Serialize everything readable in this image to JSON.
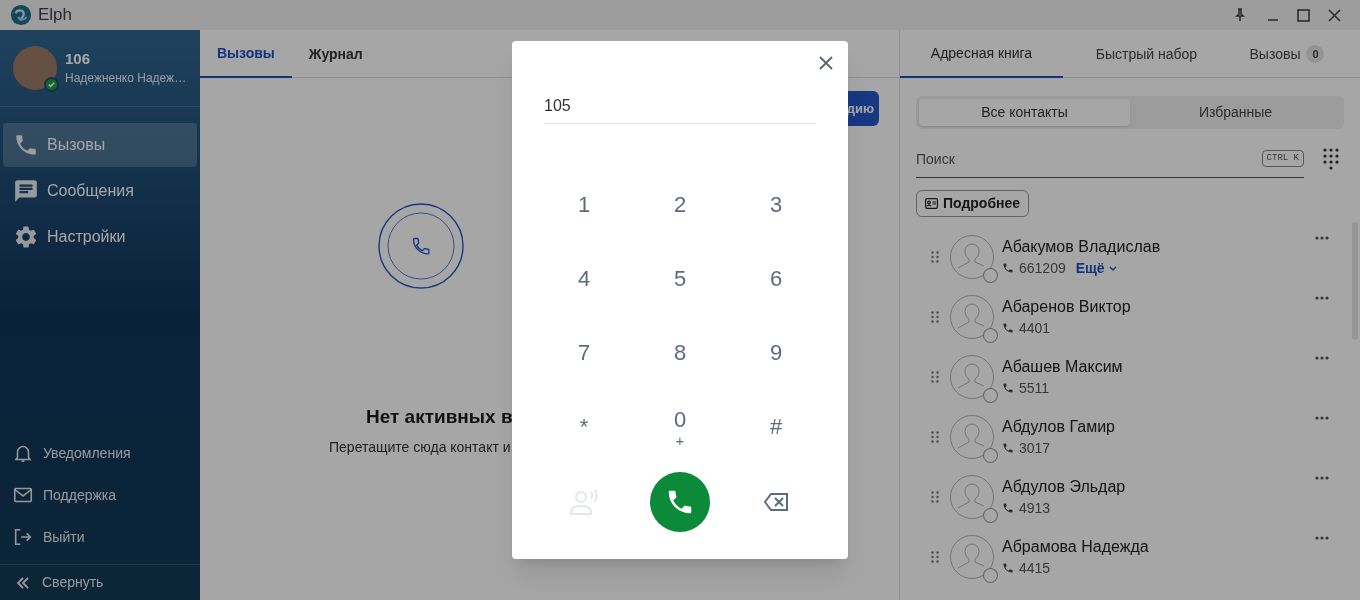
{
  "window": {
    "title": "Elph"
  },
  "user": {
    "extension": "106",
    "name": "Надежненко Надеж…",
    "online": true
  },
  "nav": [
    {
      "label": "Вызовы",
      "selected": true
    },
    {
      "label": "Сообщения",
      "selected": false
    },
    {
      "label": "Настройки",
      "selected": false
    }
  ],
  "bottom_nav": [
    {
      "label": "Уведомления"
    },
    {
      "label": "Поддержка"
    },
    {
      "label": "Выйти"
    }
  ],
  "collapse": {
    "label": "Свернуть"
  },
  "main": {
    "tabs": [
      {
        "label": "Вызовы",
        "selected": true
      },
      {
        "label": "Журнал",
        "selected": false
      }
    ],
    "action_button": "дию",
    "empty_title": "Нет активных в",
    "empty_text": "Перетащите сюда контакт и"
  },
  "contacts_panel": {
    "tabs": [
      {
        "label": "Адресная книга",
        "selected": true
      },
      {
        "label": "Быстрый набор",
        "selected": false
      },
      {
        "label": "Вызовы",
        "selected": false,
        "badge": "0"
      }
    ],
    "filters": [
      {
        "label": "Все контакты",
        "selected": true
      },
      {
        "label": "Избранные",
        "selected": false
      }
    ],
    "search": {
      "placeholder": "Поиск",
      "shortcut": "CTRL K"
    },
    "details_button": "Подробнее",
    "contacts": [
      {
        "name": "Абакумов Владислав",
        "phone": "661209",
        "more": "Ещё",
        "online": false
      },
      {
        "name": "Абаренов Виктор",
        "phone": "4401",
        "online": false
      },
      {
        "name": "Абашев Максим",
        "phone": "5511",
        "online": false
      },
      {
        "name": "Абдулов Гамир",
        "phone": "3017",
        "online": false
      },
      {
        "name": "Абдулов Эльдар",
        "phone": "4913",
        "online": false
      },
      {
        "name": "Абрамова Надежда",
        "phone": "4415",
        "online": false
      }
    ]
  },
  "dialer": {
    "value": "105",
    "keys": [
      {
        "label": "1"
      },
      {
        "label": "2"
      },
      {
        "label": "3"
      },
      {
        "label": "4"
      },
      {
        "label": "5"
      },
      {
        "label": "6"
      },
      {
        "label": "7"
      },
      {
        "label": "8"
      },
      {
        "label": "9"
      },
      {
        "label": "*"
      },
      {
        "label": "0",
        "sub": "+"
      },
      {
        "label": "#"
      }
    ],
    "voice_disabled": true
  }
}
